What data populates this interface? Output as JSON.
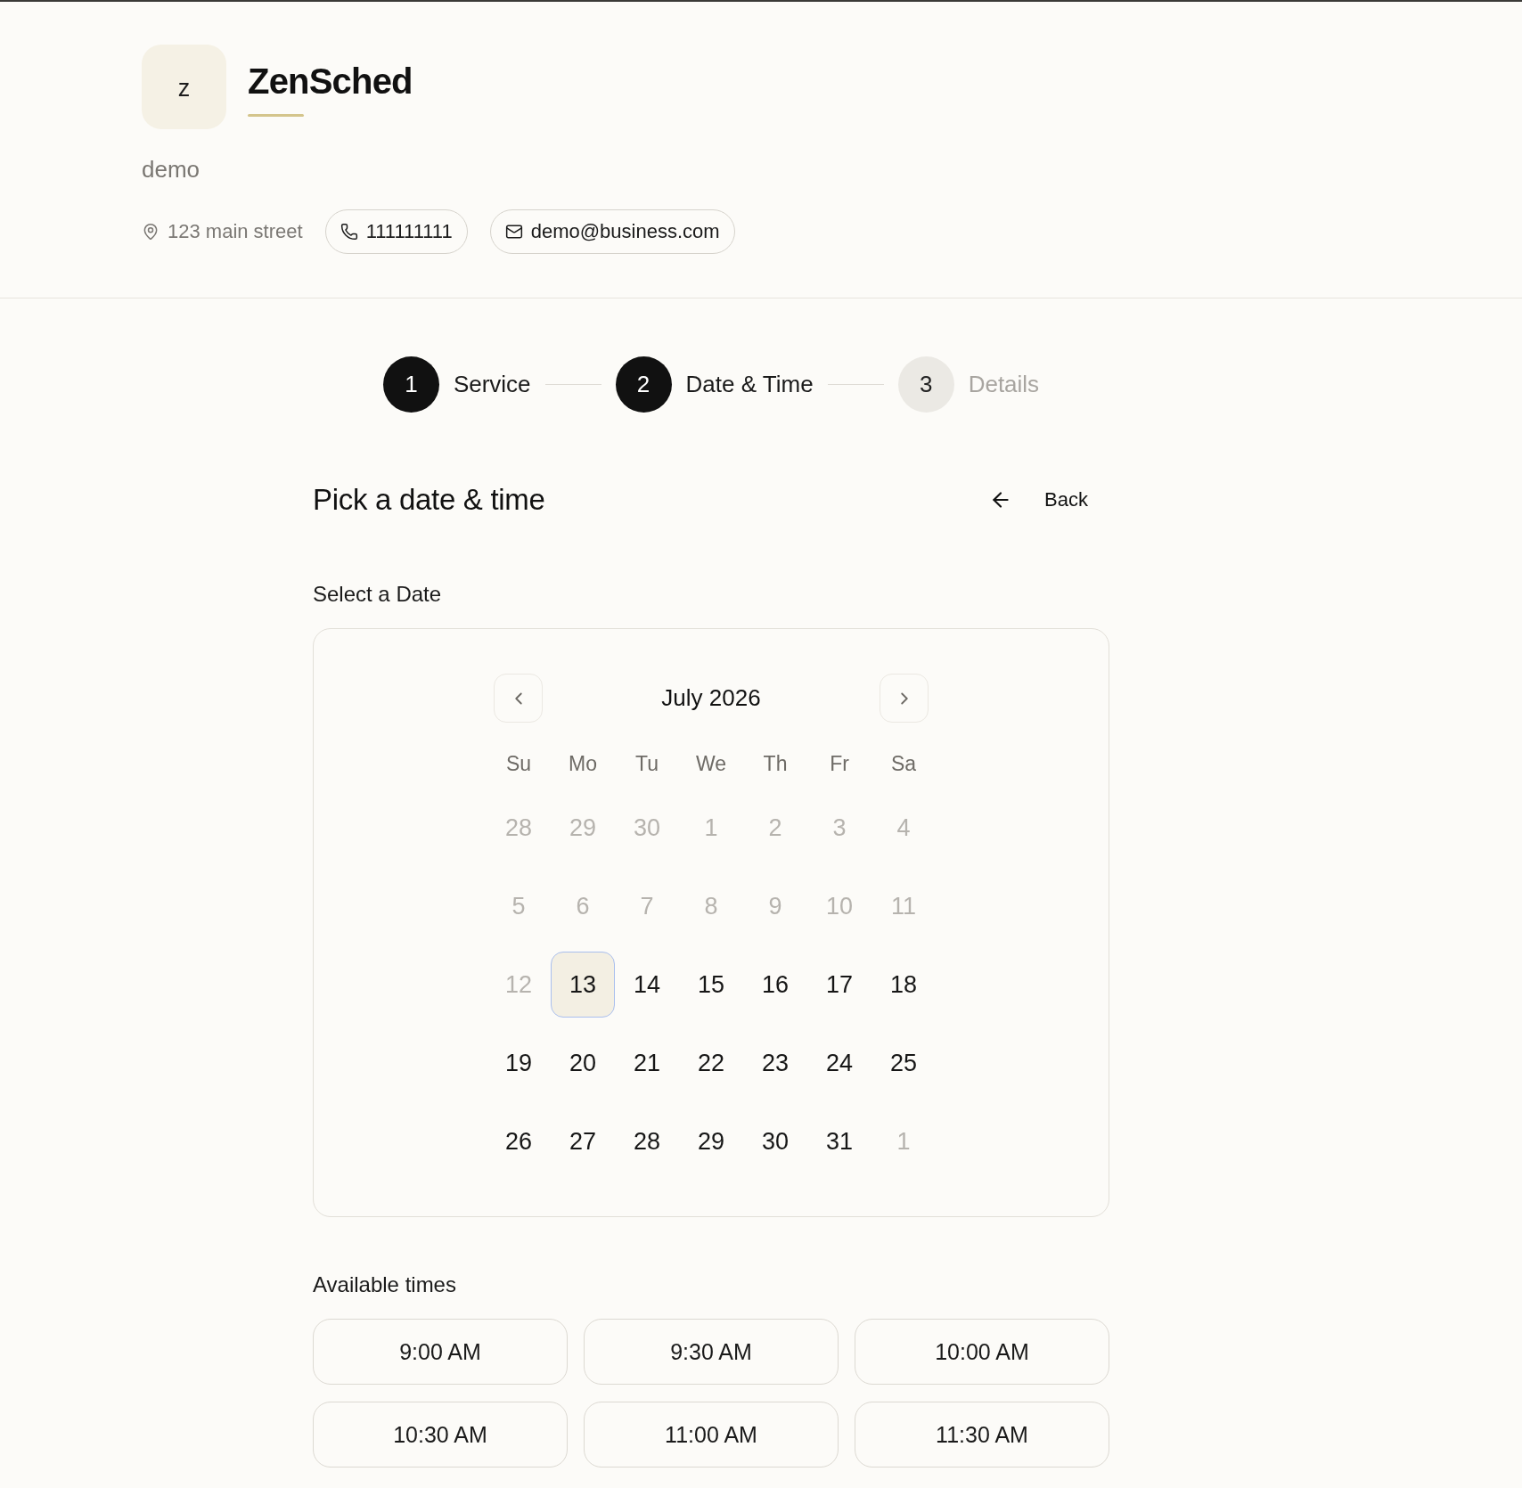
{
  "business": {
    "logo_letter": "z",
    "name": "ZenSched",
    "description": "demo",
    "address": "123 main street",
    "phone": "111111111",
    "email": "demo@business.com"
  },
  "steps": [
    {
      "number": "1",
      "label": "Service",
      "active": true
    },
    {
      "number": "2",
      "label": "Date & Time",
      "active": true
    },
    {
      "number": "3",
      "label": "Details",
      "active": false
    }
  ],
  "page": {
    "title": "Pick a date & time",
    "back_label": "Back"
  },
  "date_picker": {
    "heading": "Select a Date",
    "month": "July 2026",
    "weekdays": [
      "Su",
      "Mo",
      "Tu",
      "We",
      "Th",
      "Fr",
      "Sa"
    ],
    "weeks": [
      [
        {
          "day": "28",
          "disabled": true,
          "selected": false
        },
        {
          "day": "29",
          "disabled": true,
          "selected": false
        },
        {
          "day": "30",
          "disabled": true,
          "selected": false
        },
        {
          "day": "1",
          "disabled": true,
          "selected": false
        },
        {
          "day": "2",
          "disabled": true,
          "selected": false
        },
        {
          "day": "3",
          "disabled": true,
          "selected": false
        },
        {
          "day": "4",
          "disabled": true,
          "selected": false
        }
      ],
      [
        {
          "day": "5",
          "disabled": true,
          "selected": false
        },
        {
          "day": "6",
          "disabled": true,
          "selected": false
        },
        {
          "day": "7",
          "disabled": true,
          "selected": false
        },
        {
          "day": "8",
          "disabled": true,
          "selected": false
        },
        {
          "day": "9",
          "disabled": true,
          "selected": false
        },
        {
          "day": "10",
          "disabled": true,
          "selected": false
        },
        {
          "day": "11",
          "disabled": true,
          "selected": false
        }
      ],
      [
        {
          "day": "12",
          "disabled": true,
          "selected": false
        },
        {
          "day": "13",
          "disabled": false,
          "selected": true
        },
        {
          "day": "14",
          "disabled": false,
          "selected": false
        },
        {
          "day": "15",
          "disabled": false,
          "selected": false
        },
        {
          "day": "16",
          "disabled": false,
          "selected": false
        },
        {
          "day": "17",
          "disabled": false,
          "selected": false
        },
        {
          "day": "18",
          "disabled": false,
          "selected": false
        }
      ],
      [
        {
          "day": "19",
          "disabled": false,
          "selected": false
        },
        {
          "day": "20",
          "disabled": false,
          "selected": false
        },
        {
          "day": "21",
          "disabled": false,
          "selected": false
        },
        {
          "day": "22",
          "disabled": false,
          "selected": false
        },
        {
          "day": "23",
          "disabled": false,
          "selected": false
        },
        {
          "day": "24",
          "disabled": false,
          "selected": false
        },
        {
          "day": "25",
          "disabled": false,
          "selected": false
        }
      ],
      [
        {
          "day": "26",
          "disabled": false,
          "selected": false
        },
        {
          "day": "27",
          "disabled": false,
          "selected": false
        },
        {
          "day": "28",
          "disabled": false,
          "selected": false
        },
        {
          "day": "29",
          "disabled": false,
          "selected": false
        },
        {
          "day": "30",
          "disabled": false,
          "selected": false
        },
        {
          "day": "31",
          "disabled": false,
          "selected": false
        },
        {
          "day": "1",
          "disabled": true,
          "selected": false
        }
      ]
    ]
  },
  "times": {
    "heading": "Available times",
    "slots": [
      {
        "label": "9:00 AM",
        "selected": false
      },
      {
        "label": "9:30 AM",
        "selected": false
      },
      {
        "label": "10:00 AM",
        "selected": false
      },
      {
        "label": "10:30 AM",
        "selected": false
      },
      {
        "label": "11:00 AM",
        "selected": false
      },
      {
        "label": "11:30 AM",
        "selected": false
      }
    ]
  }
}
